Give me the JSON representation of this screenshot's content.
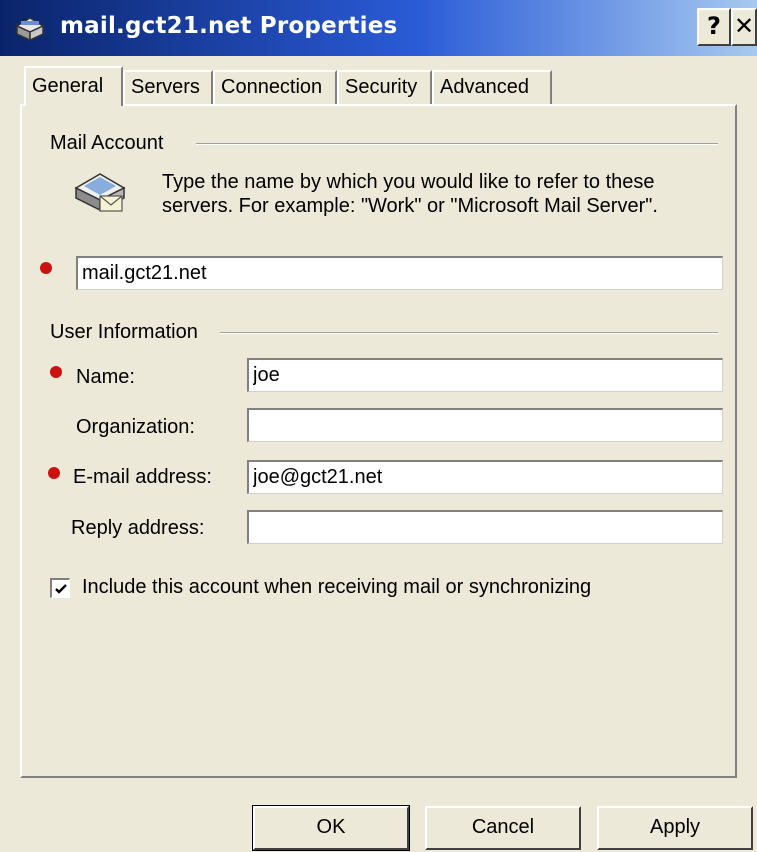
{
  "window": {
    "title": "mail.gct21.net Properties",
    "help_label": "?",
    "close_label": "✕",
    "title_gradient": [
      "#0a246a",
      "#a6caf0"
    ]
  },
  "tabs": [
    {
      "label": "General",
      "active": true
    },
    {
      "label": "Servers",
      "active": false
    },
    {
      "label": "Connection",
      "active": false
    },
    {
      "label": "Security",
      "active": false
    },
    {
      "label": "Advanced",
      "active": false
    }
  ],
  "mail_account": {
    "heading": "Mail Account",
    "icon": "mail-server-icon",
    "description": "Type the name by which you would like to refer to these servers.  For example: \"Work\" or \"Microsoft Mail Server\".",
    "account_name": "mail.gct21.net"
  },
  "user_information": {
    "heading": "User Information",
    "name_label": "Name:",
    "name_value": "joe",
    "organization_label": "Organization:",
    "organization_value": "",
    "email_label": "E-mail address:",
    "email_value": "joe@gct21.net",
    "reply_label": "Reply address:",
    "reply_value": ""
  },
  "include_account": {
    "label": "Include this account when receiving mail or synchronizing",
    "checked": true
  },
  "buttons": {
    "ok": "OK",
    "cancel": "Cancel",
    "apply": "Apply"
  },
  "required_marker_color": "#cc1111"
}
